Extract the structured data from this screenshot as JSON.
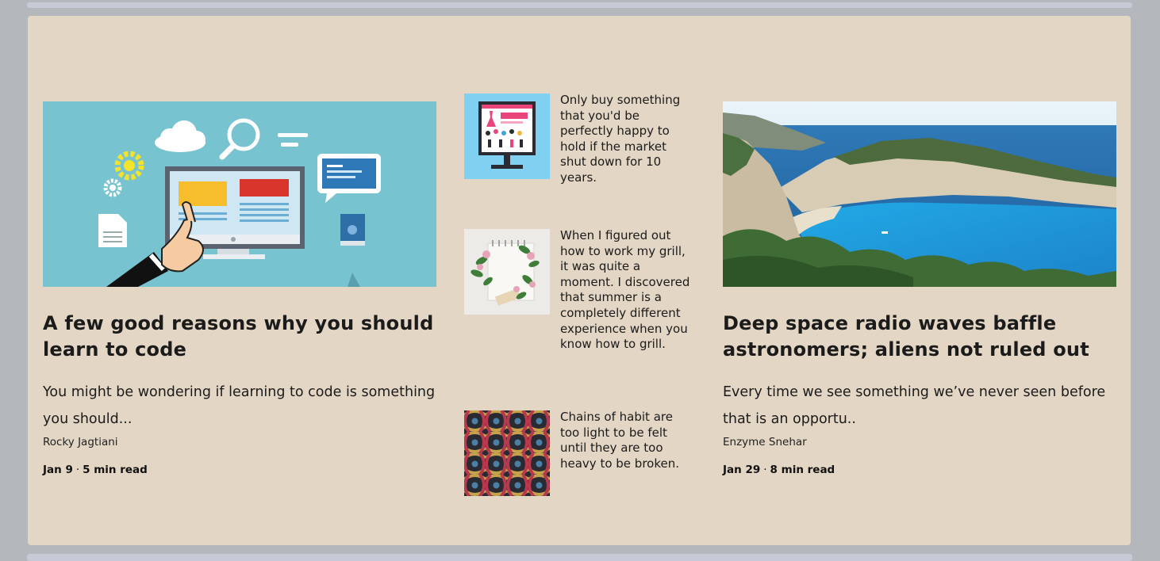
{
  "posts": [
    {
      "title": "A few good reasons why you should learn to code",
      "excerpt": "You might be wondering if learning to code is something you should...",
      "author": "Rocky Jagtiani",
      "date": "Jan 9",
      "read_time": "5 min read",
      "image_icon": "coding-illustration"
    },
    {
      "title": "Deep space radio waves baffle astronomers; aliens not ruled out",
      "excerpt": "Every time we see something we’ve never seen before that is an opportu..",
      "author": "Enzyme Snehar",
      "date": "Jan 29",
      "read_time": "8 min read",
      "image_icon": "beach-cove-photo"
    }
  ],
  "quotes": [
    {
      "text": "Only buy something that you'd be perfectly happy to hold if the market shut down for 10 years.",
      "image_icon": "shop-monitor-illustration"
    },
    {
      "text": "When I figured out how to work my grill, it was quite a moment. I discovered that summer is a completely different experience when you know how to grill.",
      "image_icon": "notebook-flowers-photo"
    },
    {
      "text": "Chains of habit are too light to be felt until they are too heavy to be broken.",
      "image_icon": "woven-pattern"
    }
  ],
  "meta_separator": "·",
  "colors": {
    "page_bg": "#b4b8bc",
    "panel_bg": "#e3d6c5",
    "bar": "#c6c9d6",
    "text": "#1b1b1b"
  }
}
